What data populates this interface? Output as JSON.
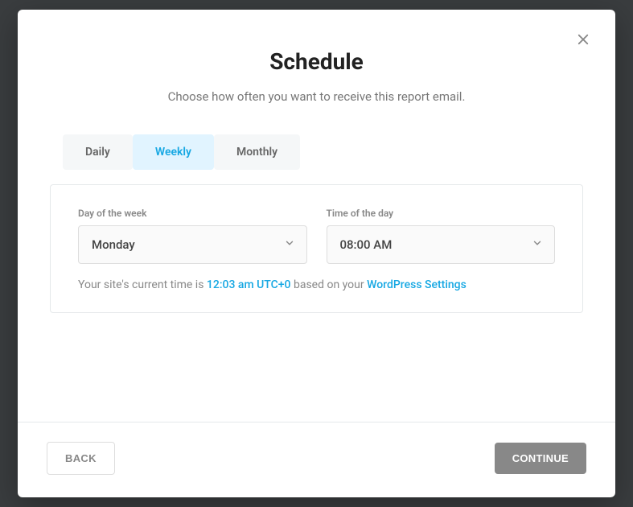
{
  "modal": {
    "title": "Schedule",
    "subtitle": "Choose how often you want to receive this report email."
  },
  "tabs": {
    "daily": "Daily",
    "weekly": "Weekly",
    "monthly": "Monthly"
  },
  "fields": {
    "day_label": "Day of the week",
    "day_value": "Monday",
    "time_label": "Time of the day",
    "time_value": "08:00 AM"
  },
  "helper": {
    "prefix": "Your site's current time is ",
    "time": "12:03 am UTC+0",
    "mid": " based on your ",
    "link": "WordPress Settings"
  },
  "footer": {
    "back": "BACK",
    "continue": "CONTINUE"
  }
}
